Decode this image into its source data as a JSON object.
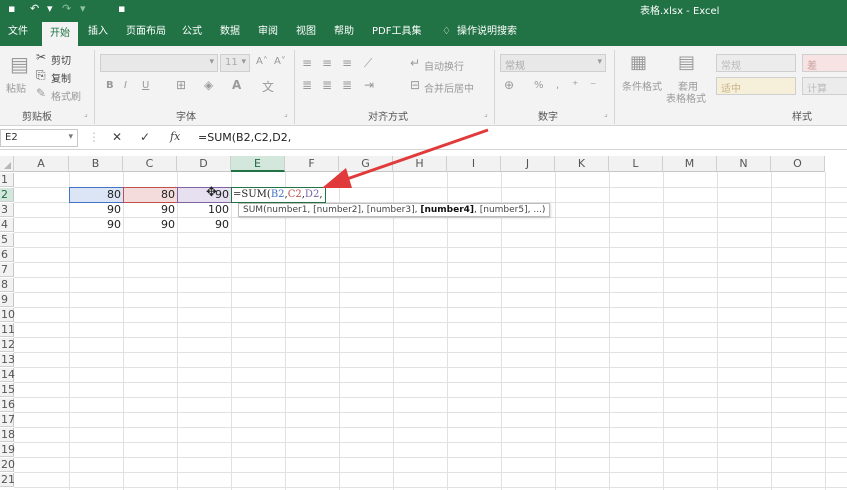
{
  "window": {
    "title": "表格.xlsx  -  Excel",
    "brand_color": "#217346"
  },
  "quick_access": {
    "save_icon": "save-icon",
    "undo_icon": "undo-icon",
    "redo_icon": "redo-icon"
  },
  "tabs": [
    "文件",
    "开始",
    "插入",
    "页面布局",
    "公式",
    "数据",
    "审阅",
    "视图",
    "帮助",
    "PDF工具集",
    "操作说明搜索"
  ],
  "active_tab": "开始",
  "ribbon": {
    "clipboard": {
      "paste": "粘贴",
      "cut": "剪切",
      "copy": "复制",
      "format_painter": "格式刷",
      "label": "剪贴板"
    },
    "font": {
      "name": "",
      "size": "11",
      "bold": "B",
      "italic": "I",
      "underline": "U",
      "label": "字体"
    },
    "alignment": {
      "wrap": "自动换行",
      "merge": "合并后居中",
      "label": "对齐方式"
    },
    "number": {
      "format": "常规",
      "percent": "%",
      "comma": ",",
      "label": "数字"
    },
    "styles": {
      "cond_format": "条件格式",
      "table_format_1": "套用",
      "table_format_2": "表格格式",
      "normal": "常规",
      "bad": "差",
      "neutral": "适中",
      "calc": "计算",
      "label": "样式"
    }
  },
  "formula_bar": {
    "name_box": "E2",
    "cancel": "✕",
    "enter": "✓",
    "fx": "fx",
    "formula": "=SUM(B2,C2,D2,"
  },
  "columns": [
    "A",
    "B",
    "C",
    "D",
    "E",
    "F",
    "G",
    "H",
    "I",
    "J",
    "K",
    "L",
    "M",
    "N",
    "O"
  ],
  "rows": [
    "1",
    "2",
    "3",
    "4",
    "5",
    "6",
    "7",
    "8",
    "9",
    "10",
    "11",
    "12",
    "13",
    "14",
    "15",
    "16",
    "17",
    "18",
    "19",
    "20",
    "21"
  ],
  "cells": {
    "B2": "80",
    "C2": "80",
    "D2": "90",
    "B3": "90",
    "C3": "90",
    "D3": "100",
    "B4": "90",
    "C4": "90",
    "D4": "90"
  },
  "editing": {
    "prefix": "=SUM(",
    "b": "B2",
    "c": "C2",
    "d": "D2",
    "sep": ",",
    "after_d": ","
  },
  "tooltip": {
    "prefix": "SUM(number1, [number2], [number3], ",
    "bold": "[number4]",
    "suffix": ", [number5], ...)"
  },
  "colors": {
    "ref_b": "#4472c4",
    "ref_c": "#c0504d",
    "ref_d": "#8064a2",
    "arrow": "#e03a3a"
  }
}
